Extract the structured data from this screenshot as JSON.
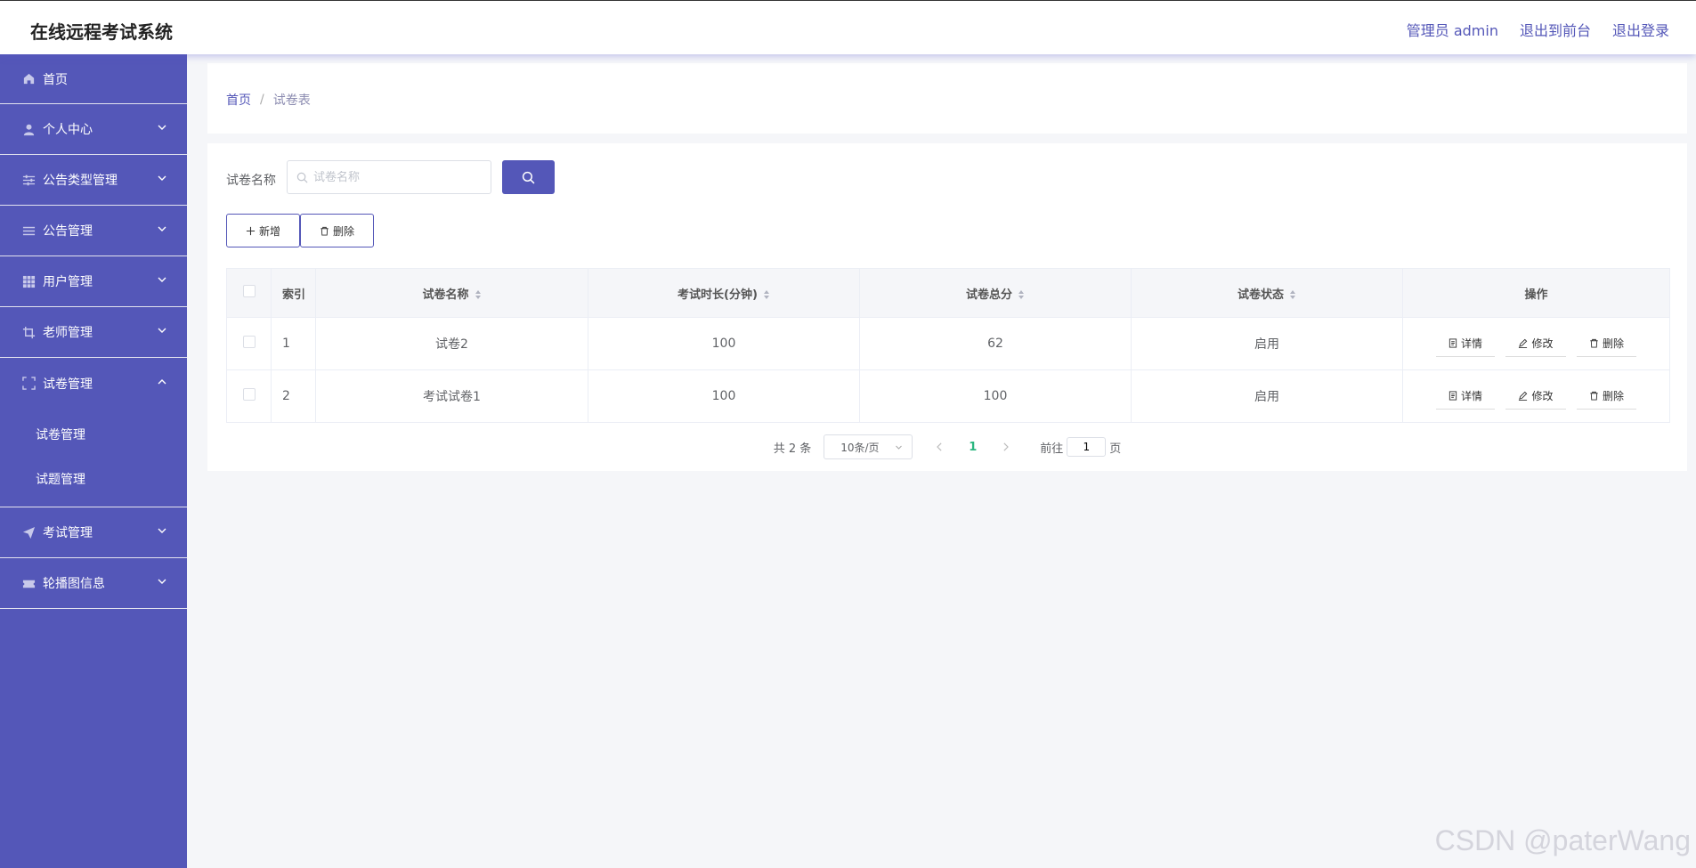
{
  "header": {
    "title": "在线远程考试系统",
    "links": [
      "管理员 admin",
      "退出到前台",
      "退出登录"
    ]
  },
  "sidebar": {
    "items": [
      {
        "label": "首页",
        "icon": "home-icon"
      },
      {
        "label": "个人中心",
        "icon": "user-icon"
      },
      {
        "label": "公告类型管理",
        "icon": "sliders-icon"
      },
      {
        "label": "公告管理",
        "icon": "list-icon"
      },
      {
        "label": "用户管理",
        "icon": "grid-icon"
      },
      {
        "label": "老师管理",
        "icon": "crop-icon"
      },
      {
        "label": "试卷管理",
        "icon": "fullscreen-icon",
        "expanded": true,
        "children": [
          "试卷管理",
          "试题管理"
        ]
      },
      {
        "label": "考试管理",
        "icon": "send-icon"
      },
      {
        "label": "轮播图信息",
        "icon": "ticket-icon"
      }
    ]
  },
  "breadcrumb": {
    "home": "首页",
    "sep": "/",
    "current": "试卷表"
  },
  "search": {
    "label": "试卷名称",
    "placeholder": "试卷名称"
  },
  "toolbar": {
    "add_label": "新增",
    "delete_label": "删除"
  },
  "table": {
    "headers": [
      "索引",
      "试卷名称",
      "考试时长(分钟)",
      "试卷总分",
      "试卷状态",
      "操作"
    ],
    "rows": [
      {
        "index": "1",
        "name": "试卷2",
        "duration": "100",
        "score": "62",
        "status": "启用"
      },
      {
        "index": "2",
        "name": "考试试卷1",
        "duration": "100",
        "score": "100",
        "status": "启用"
      }
    ],
    "actions": [
      "详情",
      "修改",
      "删除"
    ]
  },
  "pagination": {
    "total": "共 2 条",
    "page_size": "10条/页",
    "current_page": "1",
    "goto_label": "前往",
    "goto_value": "1",
    "page_suffix": "页"
  },
  "watermark": "CSDN @paterWang",
  "colors": {
    "accent": "#5457b8",
    "page_active": "#2ab67f"
  }
}
